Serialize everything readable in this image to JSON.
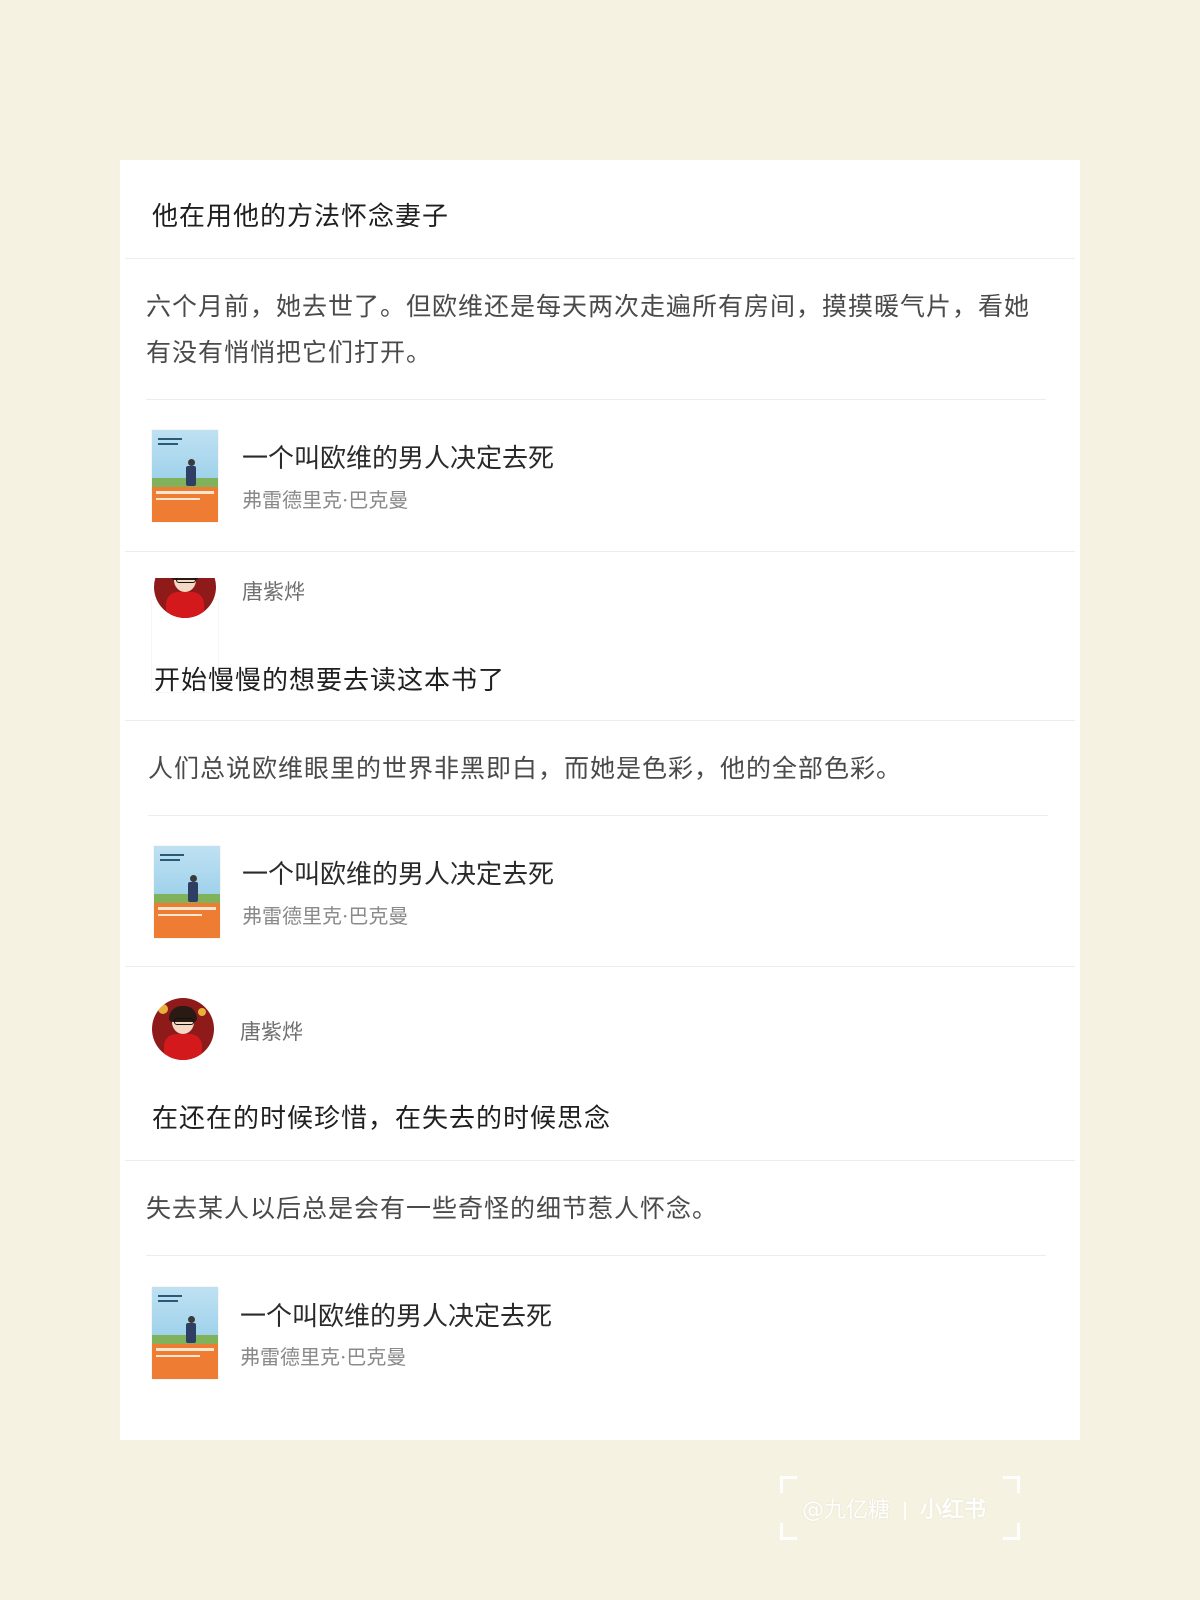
{
  "sections": [
    {
      "title": "他在用他的方法怀念妻子",
      "quote": "六个月前，她去世了。但欧维还是每天两次走遍所有房间，摸摸暖气片，看她有没有悄悄把它们打开。",
      "book": {
        "title": "一个叫欧维的男人决定去死",
        "author": "弗雷德里克·巴克曼"
      }
    },
    {
      "user": "唐紫烨",
      "title": "开始慢慢的想要去读这本书了",
      "quote": "人们总说欧维眼里的世界非黑即白，而她是色彩，他的全部色彩。",
      "book": {
        "title": "一个叫欧维的男人决定去死",
        "author": "弗雷德里克·巴克曼"
      }
    },
    {
      "user": "唐紫烨",
      "title": "在还在的时候珍惜，在失去的时候思念",
      "quote": "失去某人以后总是会有一些奇怪的细节惹人怀念。",
      "book": {
        "title": "一个叫欧维的男人决定去死",
        "author": "弗雷德里克·巴克曼"
      }
    }
  ],
  "watermark": {
    "handle": "@九亿糖",
    "brand": "小红书"
  },
  "colors": {
    "page_bg": "#f6f2e1",
    "card_bg": "#ffffff",
    "cover_orange": "#ee7d33",
    "avatar_red": "#d3191c"
  },
  "icons": {
    "book_cover": "book-cover-icon",
    "avatar": "user-avatar-icon"
  }
}
